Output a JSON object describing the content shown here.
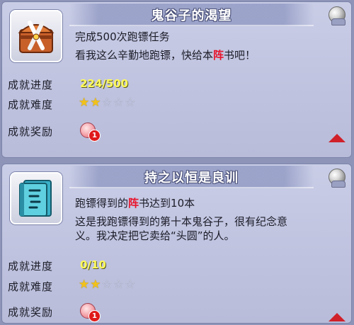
{
  "labels": {
    "progress": "成就进度",
    "difficulty": "成就难度",
    "reward": "成就奖励"
  },
  "achievements": [
    {
      "title": "鬼谷子的渴望",
      "icon": "chest-icon",
      "line1": "完成500次跑镖任务",
      "line2_pre": "看我这么辛勤地跑镖，快给本",
      "line2_red": "阵",
      "line2_post": "书吧！",
      "progress": "224/500",
      "difficulty_stars": 2,
      "difficulty_max": 5,
      "reward_badge": "1"
    },
    {
      "title": "持之以恒是良训",
      "icon": "book-icon",
      "line1_pre": "跑镖得到的",
      "line1_red": "阵",
      "line1_post": "书达到10本",
      "line2": "这是我跑镖得到的第十本鬼谷子，很有纪念意",
      "line3": "义。我决定把它卖给“头圆”的人。",
      "progress": "0/10",
      "difficulty_stars": 2,
      "difficulty_max": 5,
      "reward_badge": "1"
    }
  ],
  "colors": {
    "background": "#8d94b8",
    "card": "#c4c8e2",
    "highlight_red": "#e8142c",
    "progress_yellow": "#fffa5a",
    "star_gold": "#f2c21a"
  }
}
